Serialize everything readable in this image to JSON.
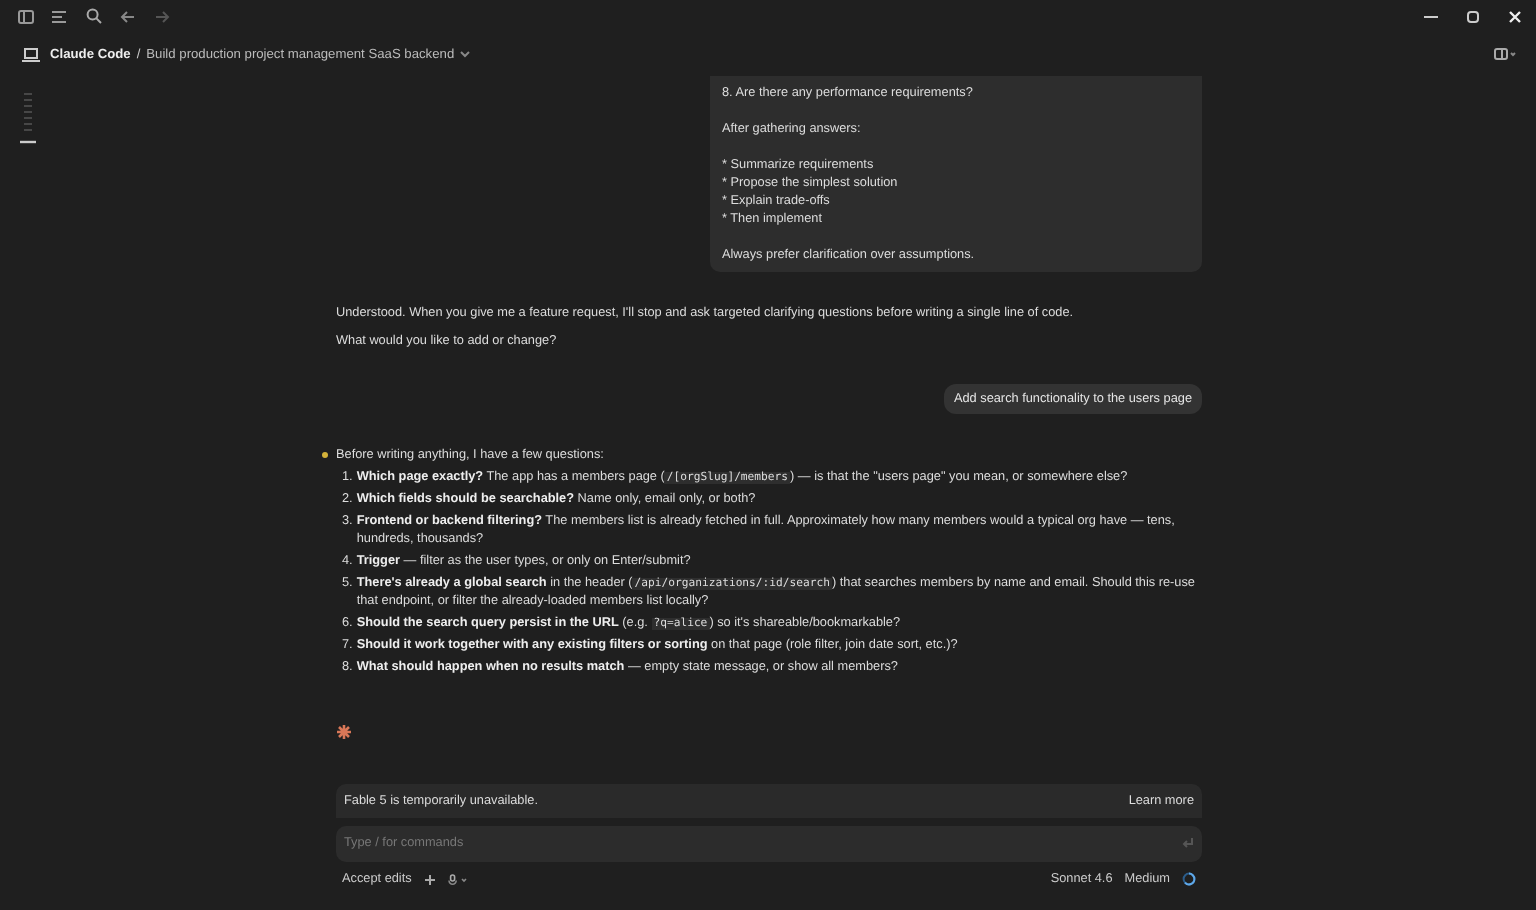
{
  "breadcrumb": {
    "project": "Claude Code",
    "separator": "/",
    "title": "Build production project management SaaS backend"
  },
  "prompt_card": {
    "lines": [
      {
        "kind": "line",
        "text": "8. Are there any performance requirements?"
      },
      {
        "kind": "gap"
      },
      {
        "kind": "line",
        "text": "After gathering answers:"
      },
      {
        "kind": "gap"
      },
      {
        "kind": "line",
        "text": "* Summarize requirements"
      },
      {
        "kind": "line",
        "text": "* Propose the simplest solution"
      },
      {
        "kind": "line",
        "text": "* Explain trade-offs"
      },
      {
        "kind": "line",
        "text": "* Then implement"
      },
      {
        "kind": "gap"
      },
      {
        "kind": "line",
        "text": "Always prefer clarification over assumptions."
      }
    ]
  },
  "assistant_reply": [
    "Understood. When you give me a feature request, I'll stop and ask targeted clarifying questions before writing a single line of code.",
    "What would you like to add or change?"
  ],
  "user_message": "Add search functionality to the users page",
  "assistant_answer": {
    "intro": "Before writing anything, I have a few questions:",
    "questions": [
      {
        "number": "1.",
        "parts": [
          {
            "kind": "bold",
            "text": "Which page exactly?"
          },
          {
            "kind": "text",
            "text": " The app has a members page ("
          },
          {
            "kind": "code",
            "text": "/[orgSlug]/members"
          },
          {
            "kind": "text",
            "text": ") — is that the \"users page\" you mean, or somewhere else?"
          }
        ]
      },
      {
        "number": "2.",
        "parts": [
          {
            "kind": "bold",
            "text": "Which fields should be searchable?"
          },
          {
            "kind": "text",
            "text": " Name only, email only, or both?"
          }
        ]
      },
      {
        "number": "3.",
        "parts": [
          {
            "kind": "bold",
            "text": "Frontend or backend filtering?"
          },
          {
            "kind": "text",
            "text": " The members list is already fetched in full. Approximately how many members would a typical org have — tens, hundreds, thousands?"
          }
        ]
      },
      {
        "number": "4.",
        "parts": [
          {
            "kind": "bold",
            "text": "Trigger"
          },
          {
            "kind": "text",
            "text": " — filter as the user types, or only on Enter/submit?"
          }
        ]
      },
      {
        "number": "5.",
        "parts": [
          {
            "kind": "bold",
            "text": "There's already a global search"
          },
          {
            "kind": "text",
            "text": " in the header ("
          },
          {
            "kind": "code",
            "text": "/api/organizations/:id/search"
          },
          {
            "kind": "text",
            "text": ") that searches members by name and email. Should this re-use that endpoint, or filter the already-loaded members list locally?"
          }
        ]
      },
      {
        "number": "6.",
        "parts": [
          {
            "kind": "bold",
            "text": "Should the search query persist in the URL"
          },
          {
            "kind": "text",
            "text": " (e.g. "
          },
          {
            "kind": "code",
            "text": "?q=alice"
          },
          {
            "kind": "text",
            "text": ") so it's shareable/bookmarkable?"
          }
        ]
      },
      {
        "number": "7.",
        "parts": [
          {
            "kind": "bold",
            "text": "Should it work together with any existing filters or sorting"
          },
          {
            "kind": "text",
            "text": " on that page (role filter, join date sort, etc.)?"
          }
        ]
      },
      {
        "number": "8.",
        "parts": [
          {
            "kind": "bold",
            "text": "What should happen when no results match"
          },
          {
            "kind": "text",
            "text": " — empty state message, or show all members?"
          }
        ]
      }
    ]
  },
  "notice": {
    "text": "Fable 5 is temporarily unavailable.",
    "link": "Learn more"
  },
  "input": {
    "placeholder": "Type / for commands"
  },
  "footer": {
    "mode": "Accept edits",
    "model": "Sonnet 4.6",
    "effort": "Medium"
  }
}
